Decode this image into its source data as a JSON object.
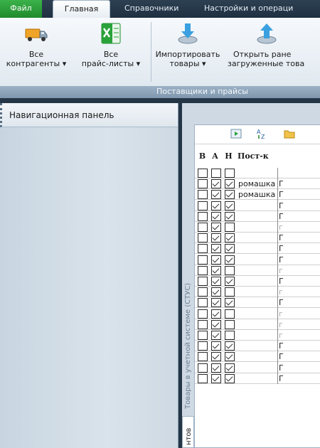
{
  "ribbon_tabs": [
    {
      "label": "Файл"
    },
    {
      "label": "Главная"
    },
    {
      "label": "Справочники"
    },
    {
      "label": "Настройки и операци"
    }
  ],
  "ribbon": {
    "buttons": [
      {
        "line1": "Все",
        "line2": "контрагенты ▾",
        "icon": "truck-icon"
      },
      {
        "line1": "Все",
        "line2": "прайс-листы ▾",
        "icon": "excel-icon"
      },
      {
        "line1": "Импортировать",
        "line2": "товары ▾",
        "icon": "import-icon"
      },
      {
        "line1": "Открыть ране",
        "line2": "загруженные това",
        "icon": "open-loaded-icon"
      }
    ],
    "group_label": "Поставщики и прайсы"
  },
  "nav_panel": {
    "title": "Навигационная панель"
  },
  "main": {
    "vertical_tab": "Товары в учетной системе (СТУС)",
    "vertical_tab2": "нтов"
  },
  "grid": {
    "columns": [
      "В",
      "А",
      "Н",
      "Пост-к"
    ],
    "rows": [
      {
        "v": false,
        "a": false,
        "n": false,
        "supplier": "",
        "g": ""
      },
      {
        "v": false,
        "a": true,
        "n": true,
        "supplier": "ромашка",
        "g": "Г"
      },
      {
        "v": false,
        "a": true,
        "n": true,
        "supplier": "ромашка",
        "g": "Г"
      },
      {
        "v": false,
        "a": true,
        "n": true,
        "supplier": "",
        "g": "Г"
      },
      {
        "v": false,
        "a": true,
        "n": true,
        "supplier": "",
        "g": "Г"
      },
      {
        "v": false,
        "a": true,
        "n": false,
        "supplier": "",
        "g": "г"
      },
      {
        "v": false,
        "a": true,
        "n": true,
        "supplier": "",
        "g": "Г"
      },
      {
        "v": false,
        "a": true,
        "n": true,
        "supplier": "",
        "g": "Г"
      },
      {
        "v": false,
        "a": true,
        "n": true,
        "supplier": "",
        "g": "Г"
      },
      {
        "v": false,
        "a": true,
        "n": false,
        "supplier": "",
        "g": "г"
      },
      {
        "v": false,
        "a": true,
        "n": true,
        "supplier": "",
        "g": "Г"
      },
      {
        "v": false,
        "a": true,
        "n": false,
        "supplier": "",
        "g": "г"
      },
      {
        "v": false,
        "a": true,
        "n": true,
        "supplier": "",
        "g": "Г"
      },
      {
        "v": false,
        "a": true,
        "n": false,
        "supplier": "",
        "g": "г"
      },
      {
        "v": false,
        "a": true,
        "n": false,
        "supplier": "",
        "g": "г"
      },
      {
        "v": false,
        "a": true,
        "n": false,
        "supplier": "",
        "g": "г"
      },
      {
        "v": false,
        "a": true,
        "n": true,
        "supplier": "",
        "g": "Г"
      },
      {
        "v": false,
        "a": true,
        "n": true,
        "supplier": "",
        "g": "Г"
      },
      {
        "v": false,
        "a": true,
        "n": true,
        "supplier": "",
        "g": "Г"
      },
      {
        "v": false,
        "a": true,
        "n": true,
        "supplier": "",
        "g": "Г"
      }
    ]
  },
  "colors": {
    "file_tab": "#2a9d38",
    "ribbon_dark": "#253647",
    "group_label": "#8aa1b7"
  }
}
